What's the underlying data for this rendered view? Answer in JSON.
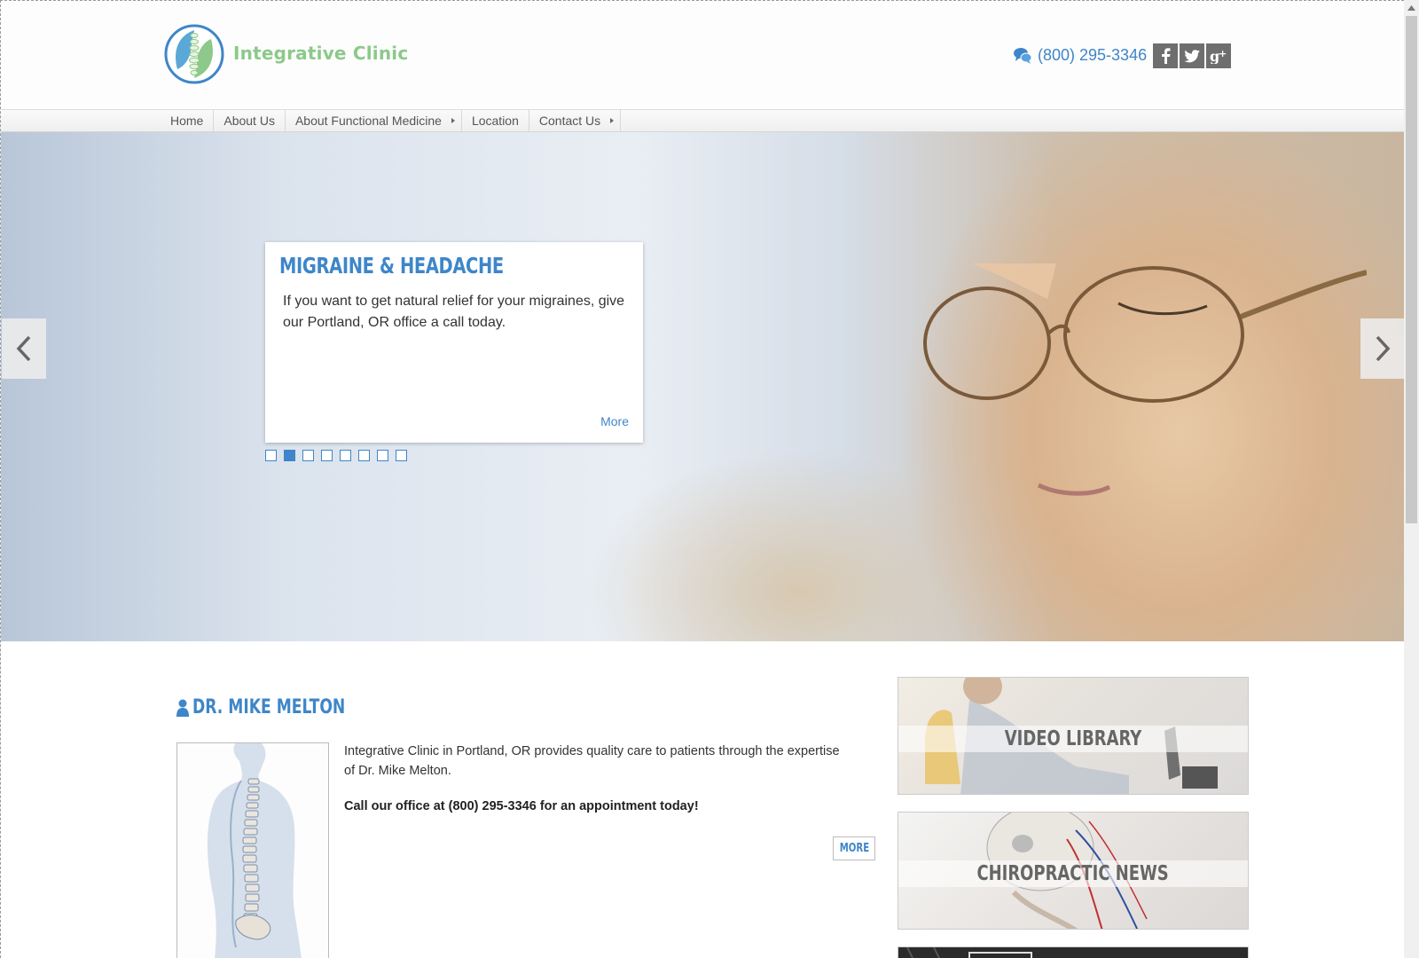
{
  "header": {
    "logo_text": "Integrative Clinic",
    "phone": "(800) 295-3346",
    "social": [
      {
        "name": "facebook",
        "glyph": "f"
      },
      {
        "name": "twitter",
        "glyph": "t"
      },
      {
        "name": "google-plus",
        "glyph": "g+"
      }
    ]
  },
  "nav": {
    "items": [
      {
        "label": "Home",
        "has_submenu": false
      },
      {
        "label": "About Us",
        "has_submenu": false
      },
      {
        "label": "About Functional Medicine",
        "has_submenu": true
      },
      {
        "label": "Location",
        "has_submenu": false
      },
      {
        "label": "Contact Us",
        "has_submenu": true
      }
    ]
  },
  "slider": {
    "title": "MIGRAINE & HEADACHE",
    "text": "If you want to get natural relief for your migraines, give our Portland, OR office a call today.",
    "more": "More",
    "slide_count": 8,
    "active_slide": 2
  },
  "doctor": {
    "title": "DR. MIKE MELTON",
    "paragraph": "Integrative Clinic in Portland, OR provides quality care to patients through the expertise of Dr. Mike Melton.",
    "call": "Call our office at (800) 295-3346 for an appointment today!",
    "more": "MORE"
  },
  "side": {
    "video_library": "VIDEO LIBRARY",
    "chiropractic_news": "CHIROPRACTIC NEWS"
  },
  "colors": {
    "accent": "#3e86c9",
    "logo_green": "#8cc98a"
  }
}
